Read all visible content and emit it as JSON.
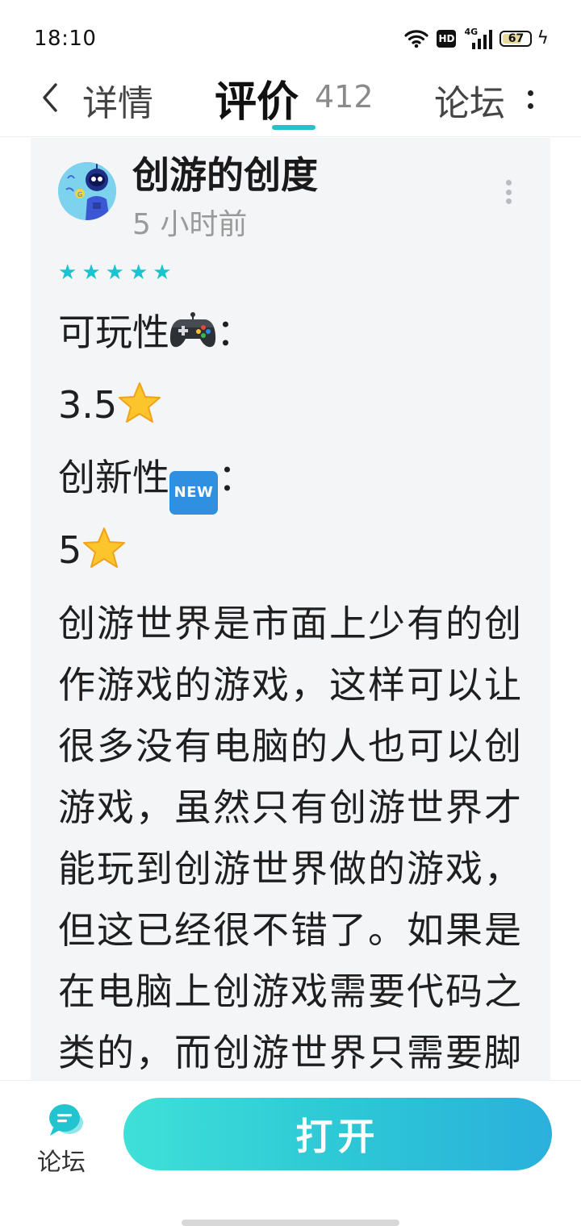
{
  "status_bar": {
    "time": "18:10",
    "hd": "HD",
    "network": "4G",
    "battery": "67"
  },
  "nav": {
    "tab_detail": "详情",
    "tab_review": "评价",
    "review_count": "412",
    "tab_forum": "论坛"
  },
  "review": {
    "user_name": "创游的创度",
    "time_ago": "5 小时前",
    "rating": 5,
    "playability_label": "可玩性",
    "playability_suffix": "：",
    "playability_score": "3.5",
    "innovation_label": "创新性",
    "innovation_suffix": "：",
    "innovation_score": "5",
    "new_badge": "NEW",
    "body": "创游世界是市面上少有的创作游戏的游戏，这样可以让很多没有电脑的人也可以创游戏，虽然只有创游世界才能玩到创游世界做的游戏，但这已经很不错了。如果是在电脑上创游戏需要代码之类的，而创游世界只需要脚本，并"
  },
  "bottom": {
    "forum_label": "论坛",
    "open_label": "打开"
  },
  "colors": {
    "accent": "#26c2cb",
    "button_start": "#3fe0d8",
    "button_end": "#2bb0dc",
    "card_bg": "#f4f5f7"
  },
  "icons": [
    "wifi-icon",
    "signal-icon",
    "battery-icon",
    "back-icon",
    "more-icon",
    "gamepad-icon",
    "star-icon",
    "new-icon",
    "forum-chat-icon"
  ]
}
